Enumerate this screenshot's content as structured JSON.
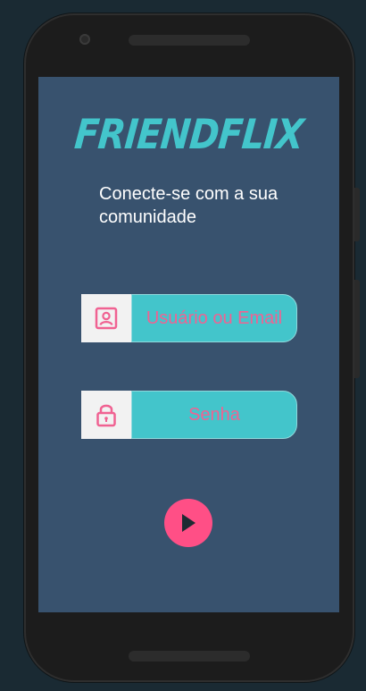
{
  "app": {
    "logo_text": "FRIENDFLIX",
    "tagline": "Conecte-se com a sua comunidade"
  },
  "login": {
    "username": {
      "placeholder": "Usuário ou Email",
      "icon": "user-card-icon"
    },
    "password": {
      "placeholder": "Senha",
      "icon": "lock-icon"
    },
    "submit": {
      "icon": "play-icon"
    }
  },
  "colors": {
    "screen_bg": "#38526e",
    "accent": "#43c5cb",
    "pink": "#f06292",
    "button": "#ff4f86"
  }
}
